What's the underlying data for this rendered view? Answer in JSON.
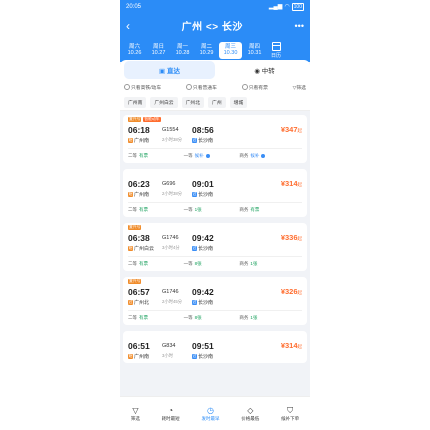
{
  "status_bar": {
    "time": "20:05",
    "battery": "100"
  },
  "header": {
    "title": "广州 <> 长沙",
    "more": "•••",
    "back": "‹"
  },
  "dates": [
    {
      "weekday": "周六",
      "date": "10.26",
      "active": false
    },
    {
      "weekday": "周日",
      "date": "10.27",
      "active": false
    },
    {
      "weekday": "周一",
      "date": "10.28",
      "active": false
    },
    {
      "weekday": "周二",
      "date": "10.29",
      "active": false
    },
    {
      "weekday": "周三",
      "date": "10.30",
      "active": true
    },
    {
      "weekday": "周四",
      "date": "10.31",
      "active": false
    }
  ],
  "calendar_label": "日历",
  "modes": {
    "direct": "直达",
    "transfer": "中转"
  },
  "filters": {
    "f1": "只看高铁/动车",
    "f2": "只看普通车",
    "f3": "只看有票",
    "f4": "筛选"
  },
  "stations": [
    "广州南",
    "广州白云",
    "广州北",
    "广州",
    "增城"
  ],
  "trains": [
    {
      "badges": [
        "复兴号",
        "智能动车"
      ],
      "dep_time": "06:18",
      "train_no": "G1554",
      "arr_time": "08:56",
      "price": "¥347",
      "price_suffix": "起",
      "dep_station": "广州南",
      "dep_tag": "始",
      "duration": "2小时38分",
      "arr_station": "长沙南",
      "arr_tag": "过",
      "seats": [
        {
          "class": "二等",
          "status": "有票"
        },
        {
          "class": "一等",
          "status": "候补"
        },
        {
          "class": "商务",
          "status": "候补"
        }
      ]
    },
    {
      "badges": [],
      "dep_time": "06:23",
      "train_no": "G696",
      "arr_time": "09:01",
      "price": "¥314",
      "price_suffix": "起",
      "dep_station": "广州南",
      "dep_tag": "始",
      "duration": "2小时38分",
      "arr_station": "长沙南",
      "arr_tag": "过",
      "seats": [
        {
          "class": "二等",
          "status": "有票"
        },
        {
          "class": "一等",
          "status": "1张"
        },
        {
          "class": "商务",
          "status": "有票"
        }
      ]
    },
    {
      "badges": [
        "复兴号"
      ],
      "dep_time": "06:38",
      "train_no": "G1746",
      "arr_time": "09:42",
      "price": "¥336",
      "price_suffix": "起",
      "dep_station": "广州白云",
      "dep_tag": "始",
      "duration": "3小时4分",
      "arr_station": "长沙南",
      "arr_tag": "过",
      "seats": [
        {
          "class": "二等",
          "status": "有票"
        },
        {
          "class": "一等",
          "status": "8张"
        },
        {
          "class": "商务",
          "status": "1张"
        }
      ]
    },
    {
      "badges": [
        "复兴号"
      ],
      "dep_time": "06:57",
      "train_no": "G1746",
      "arr_time": "09:42",
      "price": "¥326",
      "price_suffix": "起",
      "dep_station": "广州北",
      "dep_tag": "过",
      "duration": "2小时45分",
      "arr_station": "长沙南",
      "arr_tag": "过",
      "seats": [
        {
          "class": "二等",
          "status": "有票"
        },
        {
          "class": "一等",
          "status": "8张"
        },
        {
          "class": "商务",
          "status": "1张"
        }
      ]
    },
    {
      "badges": [],
      "dep_time": "06:51",
      "train_no": "G834",
      "arr_time": "09:51",
      "price": "¥314",
      "price_suffix": "起",
      "dep_station": "广州南",
      "dep_tag": "始",
      "duration": "3小时",
      "arr_station": "长沙南",
      "arr_tag": "过",
      "seats": []
    }
  ],
  "bottom_nav": [
    {
      "icon": "▽",
      "label": "筛选",
      "active": false
    },
    {
      "icon": "◔",
      "label": "耗时最短",
      "active": false
    },
    {
      "icon": "◷",
      "label": "发时最早",
      "active": true
    },
    {
      "icon": "◇",
      "label": "价格最低",
      "active": false
    },
    {
      "icon": "⛉",
      "label": "候补下单",
      "active": false
    }
  ]
}
